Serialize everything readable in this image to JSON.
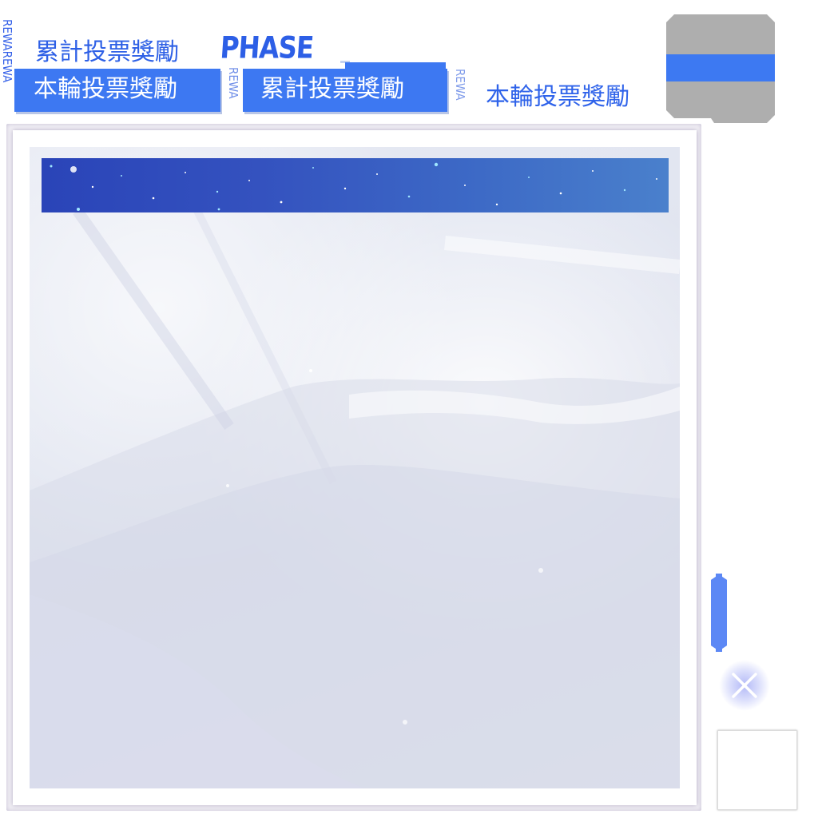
{
  "tabs": {
    "side_text": "REWAREWA",
    "side_text_short": "REWA",
    "cumulative_label": "累計投票獎勵",
    "round_label": "本輪投票獎勵",
    "phase_logo": "PHASE"
  },
  "colors": {
    "accent_blue": "#3d78f2",
    "swatch_grey": "#aeaeae",
    "star_band_start": "#2a44b8",
    "star_band_end": "#4a80cc"
  },
  "icons": {
    "close": "close-x-icon"
  }
}
